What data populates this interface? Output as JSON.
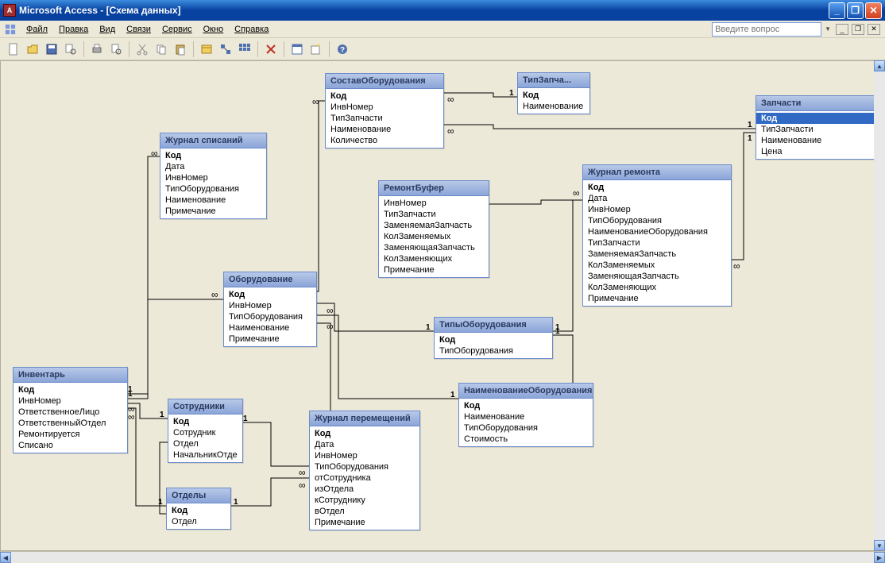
{
  "app": {
    "title": "Microsoft Access - [Схема данных]"
  },
  "menu": {
    "file": "Файл",
    "edit": "Правка",
    "view": "Вид",
    "relations": "Связи",
    "service": "Сервис",
    "window": "Окно",
    "help": "Справка",
    "ask_placeholder": "Введите вопрос"
  },
  "tables": {
    "sostav": {
      "title": "СоставОборудования",
      "fields": [
        "Код",
        "ИнвНомер",
        "ТипЗапчасти",
        "Наименование",
        "Количество"
      ],
      "pk": 0
    },
    "tipzap": {
      "title": "ТипЗапча...",
      "fields": [
        "Код",
        "Наименование"
      ],
      "pk": 0
    },
    "zapchasti": {
      "title": "Запчасти",
      "fields": [
        "Код",
        "ТипЗапчасти",
        "Наименование",
        "Цена"
      ],
      "pk": 0,
      "selected": 0
    },
    "zhurnal_spis": {
      "title": "Журнал списаний",
      "fields": [
        "Код",
        "Дата",
        "ИнвНомер",
        "ТипОборудования",
        "Наименование",
        "Примечание"
      ],
      "pk": 0
    },
    "remont_bufer": {
      "title": "РемонтБуфер",
      "fields": [
        "ИнвНомер",
        "ТипЗапчасти",
        "ЗаменяемаяЗапчасть",
        "КолЗаменяемых",
        "ЗаменяющаяЗапчасть",
        "КолЗаменяющих",
        "Примечание"
      ]
    },
    "zhurnal_remonta": {
      "title": "Журнал ремонта",
      "fields": [
        "Код",
        "Дата",
        "ИнвНомер",
        "ТипОборудования",
        "НаименованиеОборудования",
        "ТипЗапчасти",
        "ЗаменяемаяЗапчасть",
        "КолЗаменяемых",
        "ЗаменяющаяЗапчасть",
        "КолЗаменяющих",
        "Примечание"
      ],
      "pk": 0
    },
    "oborudovanie": {
      "title": "Оборудование",
      "fields": [
        "Код",
        "ИнвНомер",
        "ТипОборудования",
        "Наименование",
        "Примечание"
      ],
      "pk": 0
    },
    "tipy_oborud": {
      "title": "ТипыОборудования",
      "fields": [
        "Код",
        "ТипОборудования"
      ],
      "pk": 0
    },
    "inventar": {
      "title": "Инвентарь",
      "fields": [
        "Код",
        "ИнвНомер",
        "ОтветственноеЛицо",
        "ОтветственныйОтдел",
        "Ремонтируется",
        "Списано"
      ],
      "pk": 0
    },
    "sotrudniki": {
      "title": "Сотрудники",
      "fields": [
        "Код",
        "Сотрудник",
        "Отдел",
        "НачальникОтде"
      ],
      "pk": 0
    },
    "naim_oborud": {
      "title": "НаименованиеОборудования",
      "fields": [
        "Код",
        "Наименование",
        "ТипОборудования",
        "Стоимость"
      ],
      "pk": 0
    },
    "zhurnal_perem": {
      "title": "Журнал перемещений",
      "fields": [
        "Код",
        "Дата",
        "ИнвНомер",
        "ТипОборудования",
        "отСотрудника",
        "изОтдела",
        "кСотруднику",
        "вОтдел",
        "Примечание"
      ],
      "pk": 0
    },
    "otdely": {
      "title": "Отделы",
      "fields": [
        "Код",
        "Отдел"
      ],
      "pk": 0
    }
  },
  "rel_labels": {
    "one": "1",
    "many": "∞"
  }
}
